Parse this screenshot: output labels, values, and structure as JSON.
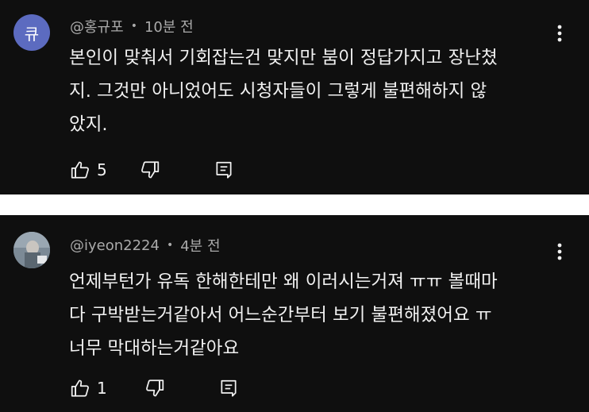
{
  "comments": [
    {
      "avatar_letter": "큐",
      "avatar_color": "#5c6bc0",
      "author": "@홍규포",
      "separator": "•",
      "time": "10분 전",
      "text": "본인이 맞춰서 기회잡는건 맞지만 붐이 정답가지고 장난쳤\n지. 그것만 아니었어도 시청자들이 그렇게 불편해하지 않\n았지.",
      "likes": "5"
    },
    {
      "avatar_color": "#6f7f8c",
      "author": "@iyeon2224",
      "separator": "•",
      "time": "4분 전",
      "text": "언제부턴가 유독 한해한테만 왜 이러시는거져 ㅠㅠ 볼때마\n다 구박받는거같아서 어느순간부터 보기 불편해졌어요 ㅠ\n너무 막대하는거같아요",
      "likes": "1"
    }
  ],
  "icons": {
    "like": "thumbs-up-icon",
    "dislike": "thumbs-down-icon",
    "reply": "reply-icon",
    "more": "more-vertical-icon"
  }
}
